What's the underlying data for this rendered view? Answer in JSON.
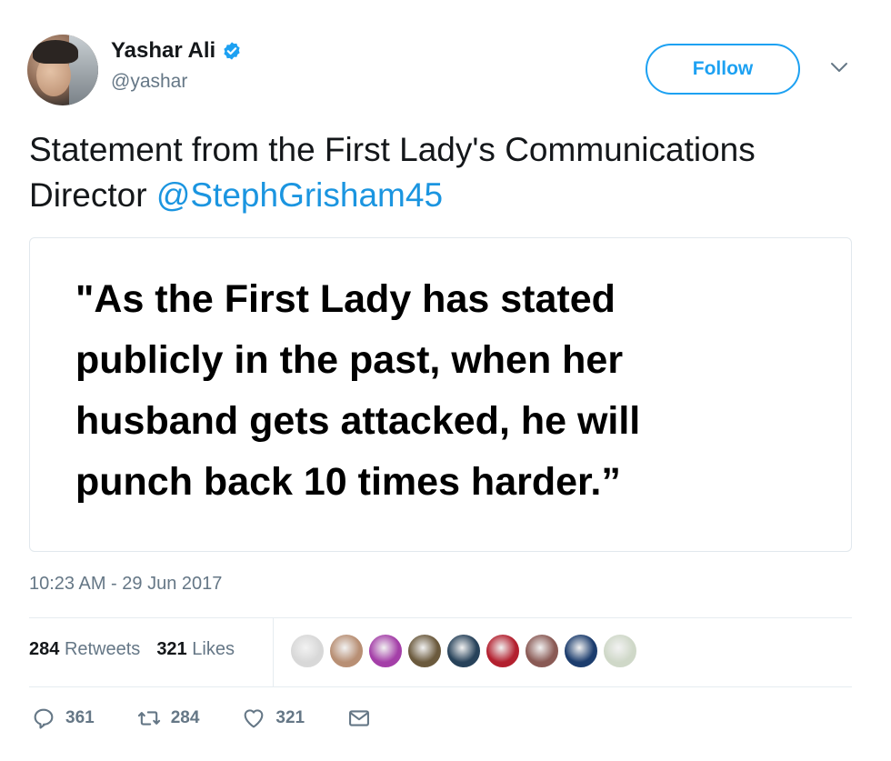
{
  "author": {
    "name": "Yashar Ali",
    "handle": "@yashar",
    "verified": true,
    "avatar_icon": "avatar-photo"
  },
  "follow_button": {
    "label": "Follow",
    "color": "#1da1f2"
  },
  "more_menu_icon": "chevron-down-icon",
  "tweet": {
    "text": "Statement from the First Lady's Communications Director ",
    "mention": "@StephGrisham45",
    "mention_color": "#1b95e0"
  },
  "quote_image": {
    "text": "\"As the First Lady has stated\npublicly in the past, when her\nhusband gets attacked, he will\npunch back 10 times harder.”"
  },
  "timestamp": "10:23 AM - 29 Jun 2017",
  "stats": {
    "retweets_count": "284",
    "retweets_label": "Retweets",
    "likes_count": "321",
    "likes_label": "Likes"
  },
  "likers": [
    {
      "icon": "liker-avatar",
      "color": "#d8d8d8"
    },
    {
      "icon": "liker-avatar",
      "color": "#b88f74"
    },
    {
      "icon": "liker-avatar",
      "color": "#a43fa8"
    },
    {
      "icon": "liker-avatar",
      "color": "#6b5a3d"
    },
    {
      "icon": "liker-avatar",
      "color": "#27425a"
    },
    {
      "icon": "liker-avatar",
      "color": "#b3202f"
    },
    {
      "icon": "liker-avatar",
      "color": "#8a5a55"
    },
    {
      "icon": "liker-avatar",
      "color": "#1c3d6e"
    },
    {
      "icon": "liker-avatar",
      "color": "#cfd8c8"
    }
  ],
  "actions": {
    "reply_count": "361",
    "retweet_count": "284",
    "like_count": "321"
  },
  "colors": {
    "text": "#14171a",
    "secondary": "#657786",
    "border": "#e1e8ed"
  }
}
